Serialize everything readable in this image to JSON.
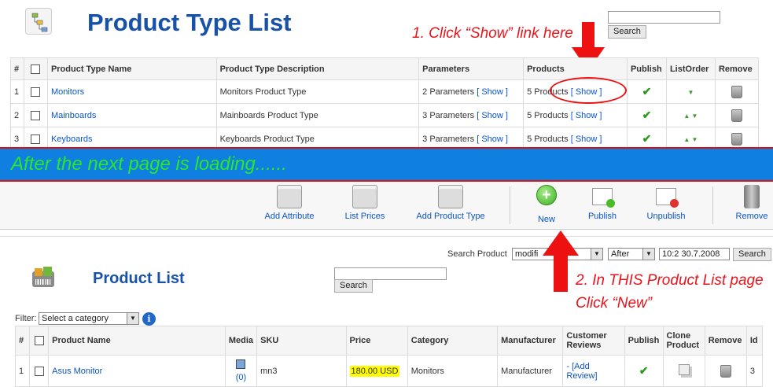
{
  "top": {
    "title": "Product Type List",
    "search_button": "Search",
    "annotation": "1. Click “Show” link here",
    "columns": [
      "#",
      "",
      "Product Type Name",
      "Product Type Description",
      "Parameters",
      "Products",
      "Publish",
      "ListOrder",
      "Remove"
    ],
    "rows": [
      {
        "num": "1",
        "name": "Monitors",
        "description": "Monitors Product Type",
        "params_text": "2 Parameters",
        "params_link": "[ Show ]",
        "products_text": "5 Products",
        "products_link": "[ Show ]",
        "order": "▼"
      },
      {
        "num": "2",
        "name": "Mainboards",
        "description": "Mainboards Product Type",
        "params_text": "3 Parameters",
        "params_link": "[ Show ]",
        "products_text": "5 Products",
        "products_link": "[ Show ]",
        "order": "▲ ▼"
      },
      {
        "num": "3",
        "name": "Keyboards",
        "description": "Keyboards Product Type",
        "params_text": "3 Parameters",
        "params_link": "[ Show ]",
        "products_text": "5 Products",
        "products_link": "[ Show ]",
        "order": "▲ ▼"
      }
    ]
  },
  "banner": {
    "text": "After the next page is loading......"
  },
  "toolbar": {
    "add_attribute": "Add Attribute",
    "list_prices": "List Prices",
    "add_product_type": "Add Product Type",
    "new": "New",
    "publish": "Publish",
    "unpublish": "Unpublish",
    "remove": "Remove"
  },
  "bottom": {
    "title": "Product List",
    "search_product_label": "Search Product",
    "search_field_value": "modifi",
    "after_select": "After",
    "date_value": "10:2 30.7.2008",
    "search_button": "Search",
    "search_button_2": "Search",
    "filter_label": "Filter:",
    "category_select": "Select a category",
    "annotation_line1": "2. In THIS Product List page",
    "annotation_line2": "Click “New”",
    "columns": [
      "#",
      "",
      "Product Name",
      "Media",
      "SKU",
      "Price",
      "Category",
      "Manufacturer",
      "Customer Reviews",
      "Publish",
      "Clone Product",
      "Remove",
      "Id"
    ],
    "rows": [
      {
        "num": "1",
        "name": "Asus Monitor",
        "media_count": "(0)",
        "sku": "mn3",
        "price": "180.00 USD",
        "category": "Monitors",
        "manufacturer": "Manufacturer",
        "reviews": "- [Add Review]",
        "id": "3"
      }
    ]
  },
  "colors": {
    "title_blue": "#1852a8",
    "link_blue": "#0b55c4",
    "annotation_red": "#e8141b",
    "banner_blue": "#0f7fe0",
    "banner_text_green": "#29e82a",
    "price_highlight": "#fffb00"
  }
}
